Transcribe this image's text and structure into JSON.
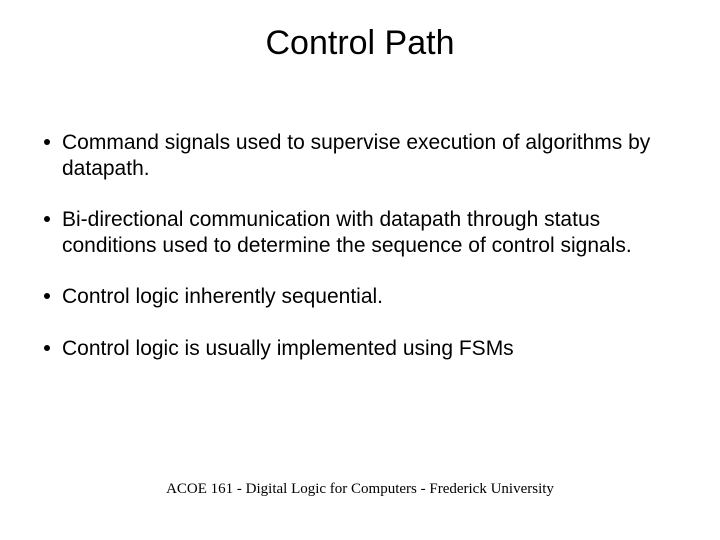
{
  "title": "Control Path",
  "bullets": [
    "Command signals used to supervise execution of algorithms by datapath.",
    "Bi-directional communication with datapath through status conditions used to determine the sequence of control signals.",
    "Control logic inherently sequential.",
    "Control logic is usually implemented using FSMs"
  ],
  "footer": "ACOE 161 - Digital Logic for Computers - Frederick University"
}
